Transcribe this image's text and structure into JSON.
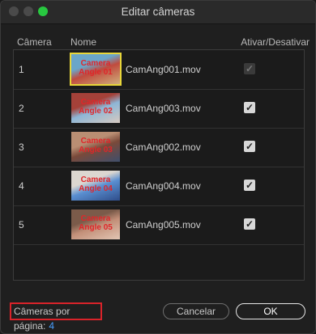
{
  "window": {
    "title": "Editar câmeras"
  },
  "columns": {
    "camera": "Câmera",
    "name": "Nome",
    "toggle": "Ativar/Desativar"
  },
  "rows": [
    {
      "number": "1",
      "thumb_label": "Camera Angle 01",
      "file": "CamAng001.mov",
      "enabled": true,
      "check_disabled": true,
      "selected": true,
      "thumb_colors": [
        "#c04b3e",
        "#6aa6c9",
        "#cfae7b"
      ]
    },
    {
      "number": "2",
      "thumb_label": "Camera Angle 02",
      "file": "CamAng003.mov",
      "enabled": true,
      "check_disabled": false,
      "selected": false,
      "thumb_colors": [
        "#8eb6d6",
        "#a44139",
        "#d7c9c0"
      ]
    },
    {
      "number": "3",
      "thumb_label": "Camera Angle 03",
      "file": "CamAng002.mov",
      "enabled": true,
      "check_disabled": false,
      "selected": false,
      "thumb_colors": [
        "#7a4a3a",
        "#b98e73",
        "#3f4e6b"
      ]
    },
    {
      "number": "4",
      "thumb_label": "Camera Angle 04",
      "file": "CamAng004.mov",
      "enabled": true,
      "check_disabled": false,
      "selected": false,
      "thumb_colors": [
        "#5a8fd1",
        "#dcd7d0",
        "#2f4d8a"
      ]
    },
    {
      "number": "5",
      "thumb_label": "Camera Angle 05",
      "file": "CamAng005.mov",
      "enabled": true,
      "check_disabled": false,
      "selected": false,
      "thumb_colors": [
        "#c28f78",
        "#7b5b4a",
        "#e2c6b4"
      ]
    }
  ],
  "footer": {
    "cameras_per_page_label": "Câmeras por página:",
    "cameras_per_page_value": "4",
    "cancel_label": "Cancelar",
    "ok_label": "OK"
  },
  "colors": {
    "accent": "#4a9fff",
    "highlight_border": "#d9232a",
    "selection": "#e8d63a",
    "thumb_text": "#e0262a"
  },
  "icons": {
    "checkbox": "checkmark-icon"
  }
}
